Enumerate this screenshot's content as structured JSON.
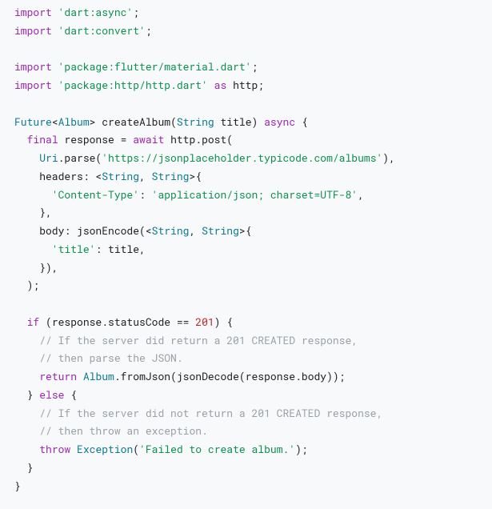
{
  "code": {
    "lines": [
      {
        "tokens": [
          {
            "t": "import ",
            "c": "kw"
          },
          {
            "t": "'dart:async'",
            "c": "str"
          },
          {
            "t": ";",
            "c": "punct"
          }
        ]
      },
      {
        "tokens": [
          {
            "t": "import ",
            "c": "kw"
          },
          {
            "t": "'dart:convert'",
            "c": "str"
          },
          {
            "t": ";",
            "c": "punct"
          }
        ]
      },
      {
        "tokens": []
      },
      {
        "tokens": [
          {
            "t": "import ",
            "c": "kw"
          },
          {
            "t": "'package:flutter/material.dart'",
            "c": "str"
          },
          {
            "t": ";",
            "c": "punct"
          }
        ]
      },
      {
        "tokens": [
          {
            "t": "import ",
            "c": "kw"
          },
          {
            "t": "'package:http/http.dart'",
            "c": "str"
          },
          {
            "t": " as ",
            "c": "kw"
          },
          {
            "t": "http",
            "c": "ident"
          },
          {
            "t": ";",
            "c": "punct"
          }
        ]
      },
      {
        "tokens": []
      },
      {
        "tokens": [
          {
            "t": "Future",
            "c": "type"
          },
          {
            "t": "<",
            "c": "punct"
          },
          {
            "t": "Album",
            "c": "type"
          },
          {
            "t": "> ",
            "c": "punct"
          },
          {
            "t": "createAlbum",
            "c": "ident"
          },
          {
            "t": "(",
            "c": "punct"
          },
          {
            "t": "String",
            "c": "type"
          },
          {
            "t": " title) ",
            "c": "ident"
          },
          {
            "t": "async",
            "c": "kw"
          },
          {
            "t": " {",
            "c": "punct"
          }
        ]
      },
      {
        "tokens": [
          {
            "t": "  ",
            "c": "punct"
          },
          {
            "t": "final",
            "c": "kw"
          },
          {
            "t": " response = ",
            "c": "ident"
          },
          {
            "t": "await",
            "c": "kw"
          },
          {
            "t": " http.post(",
            "c": "ident"
          }
        ]
      },
      {
        "tokens": [
          {
            "t": "    ",
            "c": "punct"
          },
          {
            "t": "Uri",
            "c": "type"
          },
          {
            "t": ".parse(",
            "c": "ident"
          },
          {
            "t": "'https://jsonplaceholder.typicode.com/albums'",
            "c": "str"
          },
          {
            "t": "),",
            "c": "punct"
          }
        ]
      },
      {
        "tokens": [
          {
            "t": "    headers: <",
            "c": "ident"
          },
          {
            "t": "String",
            "c": "type"
          },
          {
            "t": ", ",
            "c": "punct"
          },
          {
            "t": "String",
            "c": "type"
          },
          {
            "t": ">{",
            "c": "punct"
          }
        ]
      },
      {
        "tokens": [
          {
            "t": "      ",
            "c": "punct"
          },
          {
            "t": "'Content-Type'",
            "c": "str"
          },
          {
            "t": ": ",
            "c": "punct"
          },
          {
            "t": "'application/json; charset=UTF-8'",
            "c": "str"
          },
          {
            "t": ",",
            "c": "punct"
          }
        ]
      },
      {
        "tokens": [
          {
            "t": "    },",
            "c": "punct"
          }
        ]
      },
      {
        "tokens": [
          {
            "t": "    body: jsonEncode(<",
            "c": "ident"
          },
          {
            "t": "String",
            "c": "type"
          },
          {
            "t": ", ",
            "c": "punct"
          },
          {
            "t": "String",
            "c": "type"
          },
          {
            "t": ">{",
            "c": "punct"
          }
        ]
      },
      {
        "tokens": [
          {
            "t": "      ",
            "c": "punct"
          },
          {
            "t": "'title'",
            "c": "str"
          },
          {
            "t": ": title,",
            "c": "ident"
          }
        ]
      },
      {
        "tokens": [
          {
            "t": "    }),",
            "c": "punct"
          }
        ]
      },
      {
        "tokens": [
          {
            "t": "  );",
            "c": "punct"
          }
        ]
      },
      {
        "tokens": []
      },
      {
        "tokens": [
          {
            "t": "  ",
            "c": "punct"
          },
          {
            "t": "if",
            "c": "kw"
          },
          {
            "t": " (response.statusCode == ",
            "c": "ident"
          },
          {
            "t": "201",
            "c": "num"
          },
          {
            "t": ") {",
            "c": "punct"
          }
        ]
      },
      {
        "tokens": [
          {
            "t": "    ",
            "c": "punct"
          },
          {
            "t": "// If the server did return a 201 CREATED response,",
            "c": "comment"
          }
        ]
      },
      {
        "tokens": [
          {
            "t": "    ",
            "c": "punct"
          },
          {
            "t": "// then parse the JSON.",
            "c": "comment"
          }
        ]
      },
      {
        "tokens": [
          {
            "t": "    ",
            "c": "punct"
          },
          {
            "t": "return",
            "c": "kw"
          },
          {
            "t": " ",
            "c": "punct"
          },
          {
            "t": "Album",
            "c": "type"
          },
          {
            "t": ".fromJson(jsonDecode(response.body));",
            "c": "ident"
          }
        ]
      },
      {
        "tokens": [
          {
            "t": "  } ",
            "c": "punct"
          },
          {
            "t": "else",
            "c": "kw"
          },
          {
            "t": " {",
            "c": "punct"
          }
        ]
      },
      {
        "tokens": [
          {
            "t": "    ",
            "c": "punct"
          },
          {
            "t": "// If the server did not return a 201 CREATED response,",
            "c": "comment"
          }
        ]
      },
      {
        "tokens": [
          {
            "t": "    ",
            "c": "punct"
          },
          {
            "t": "// then throw an exception.",
            "c": "comment"
          }
        ]
      },
      {
        "tokens": [
          {
            "t": "    ",
            "c": "punct"
          },
          {
            "t": "throw",
            "c": "kw"
          },
          {
            "t": " ",
            "c": "punct"
          },
          {
            "t": "Exception",
            "c": "type"
          },
          {
            "t": "(",
            "c": "punct"
          },
          {
            "t": "'Failed to create album.'",
            "c": "str"
          },
          {
            "t": ");",
            "c": "punct"
          }
        ]
      },
      {
        "tokens": [
          {
            "t": "  }",
            "c": "punct"
          }
        ]
      },
      {
        "tokens": [
          {
            "t": "}",
            "c": "punct"
          }
        ]
      }
    ]
  }
}
